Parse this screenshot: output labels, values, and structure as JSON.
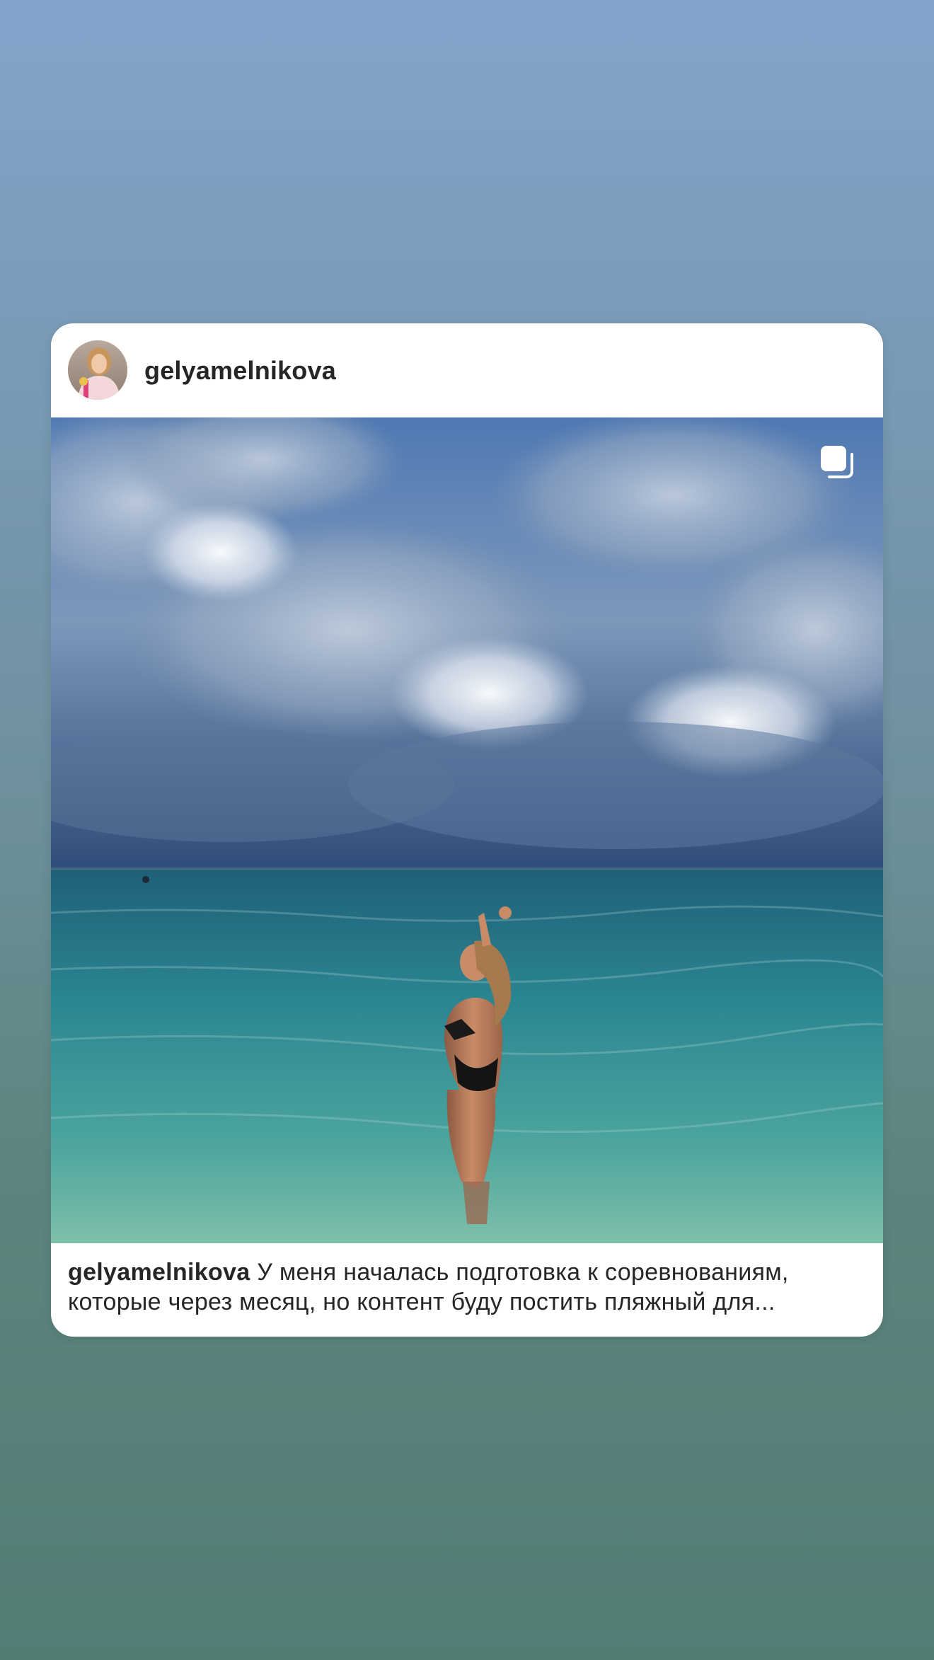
{
  "post": {
    "username": "gelyamelnikova",
    "caption": {
      "username": "gelyamelnikova",
      "line1": " У меня началась подготовка к соревнованиям,",
      "line2": "которые через месяц, но контент буду постить пляжный для..."
    },
    "carousel_icon": "carousel-multiple-icon"
  },
  "colors": {
    "background_top": "#84a3cb",
    "background_bottom": "#527d75",
    "card": "#ffffff",
    "text": "#262626"
  }
}
